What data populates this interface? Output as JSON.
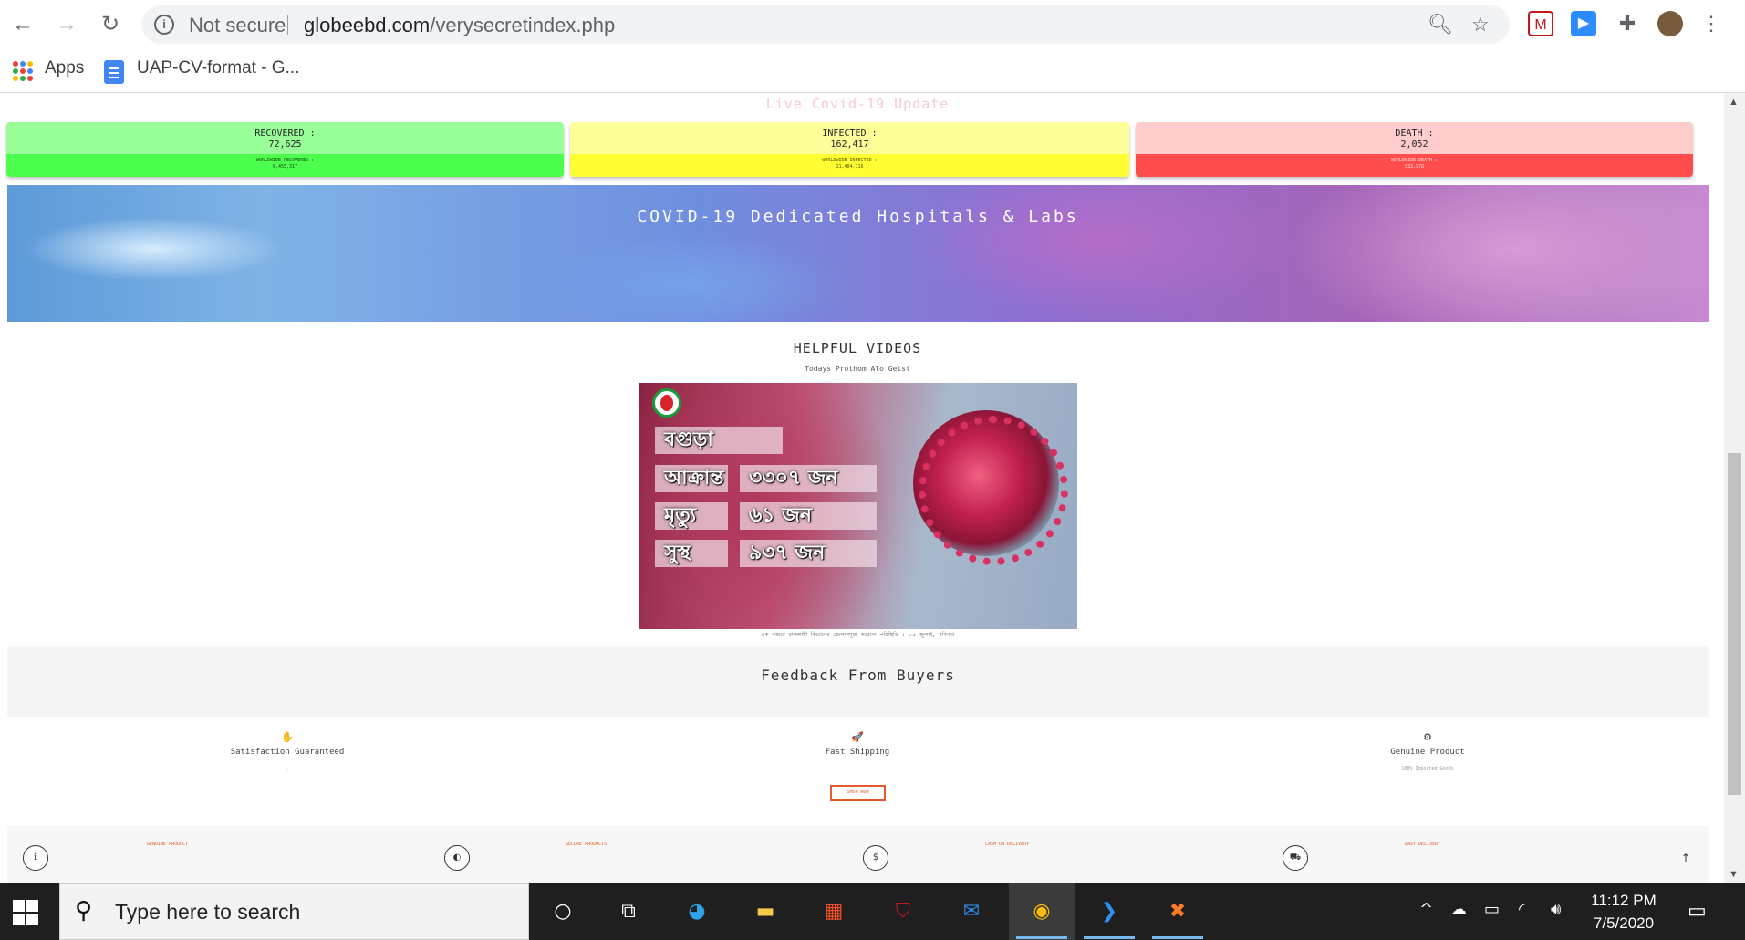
{
  "browser": {
    "security_label": "Not secure",
    "url_host": "globeebd.com",
    "url_path": "/verysecretindex.php",
    "bookmarks": [
      {
        "label": "Apps"
      },
      {
        "label": "UAP-CV-format - G..."
      }
    ]
  },
  "page": {
    "live_title": "Live Covid-19 Update",
    "stats": {
      "recovered": {
        "label": "RECOVERED :",
        "value": "72,625",
        "world_label": "WORLDWIDE RECOVERED :",
        "world_value": "6,455,317"
      },
      "infected": {
        "label": "INFECTED :",
        "value": "162,417",
        "world_label": "WORLDWIDE INFECTED :",
        "world_value": "11,404,116"
      },
      "death": {
        "label": "DEATH :",
        "value": "2,052",
        "world_label": "WORLDWIDE DEATH :",
        "world_value": "533,978"
      }
    },
    "banner_title": "COVID-19 Dedicated Hospitals & Labs",
    "helpful": {
      "title": "HELPFUL VIDEOS",
      "subtitle": "Todays Prothom Alo Geist"
    },
    "video": {
      "place": "বগুড়া",
      "rows": [
        {
          "label": "আক্রান্ত",
          "value": "৩৩০৭ জন"
        },
        {
          "label": "মৃত্যু",
          "value": "৬১ জন"
        },
        {
          "label": "সুস্থ",
          "value": "৯৩৭ জন"
        }
      ],
      "caption": "এক নজরে রাজশাহী বিভাগের জেলাসমূহে করোনা পরিস্থিতি : ০৫ জুলাই, রবিবার"
    },
    "feedback_title": "Feedback From Buyers",
    "features": [
      {
        "icon": "hand-icon",
        "glyph": "✋",
        "title": "Satisfaction Guaranteed",
        "sub": "."
      },
      {
        "icon": "rocket-icon",
        "glyph": "🚀",
        "title": "Fast Shipping",
        "sub": "."
      },
      {
        "icon": "gear-icon",
        "glyph": "⚙",
        "title": "Genuine Product",
        "sub": "100% Imported Goods"
      }
    ],
    "shop_now": "SHOP NOW",
    "footer_items": [
      {
        "icon": "info-icon",
        "glyph": "ℹ",
        "label": "GENUINE PRODUCT"
      },
      {
        "icon": "shield-icon",
        "glyph": "◐",
        "label": "SECURE PRODUCTS"
      },
      {
        "icon": "dollar-icon",
        "glyph": "$",
        "label": "CASH ON DELIVERY"
      },
      {
        "icon": "truck-icon",
        "glyph": "⛟",
        "label": "EASY DELIVERY"
      }
    ],
    "back_to_top": "↑"
  },
  "taskbar": {
    "search_placeholder": "Type here to search",
    "time": "11:12 PM",
    "date": "7/5/2020"
  },
  "colors": {
    "recovered_top": "#99ff99",
    "recovered_bottom": "#4dff4d",
    "infected_top": "#ffff99",
    "infected_bottom": "#ffff33",
    "death_top": "#ffcccc",
    "death_bottom": "#ff4d4d",
    "accent_orange": "#e35b2c"
  }
}
